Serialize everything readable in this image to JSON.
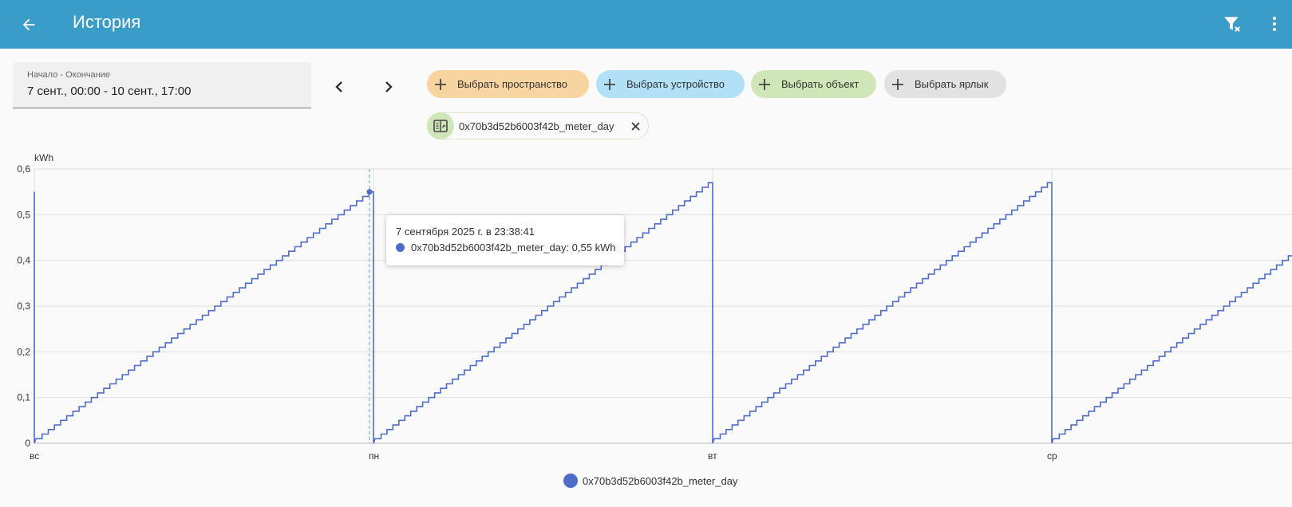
{
  "header": {
    "title": "История",
    "back_icon": "arrow-left-icon",
    "filter_icon": "filter-remove-icon",
    "menu_icon": "dots-vertical-icon",
    "bg_color": "#3a9cc9"
  },
  "date_range": {
    "label": "Начало - Окончание",
    "value": "7 сент., 00:00 - 10 сент., 17:00"
  },
  "nav": {
    "prev_icon": "chevron-left-icon",
    "next_icon": "chevron-right-icon"
  },
  "chips": {
    "area": {
      "label": "Выбрать пространство",
      "color": "#f8d4a1"
    },
    "device": {
      "label": "Выбрать устройство",
      "color": "#b2e0f6"
    },
    "entity": {
      "label": "Выбрать объект",
      "color": "#cfe6b8"
    },
    "label": {
      "label": "Выбрать ярлык",
      "color": "#e2e2e2"
    }
  },
  "selected_entity": {
    "name": "0x70b3d52b6003f42b_meter_day",
    "icon": "meter-icon",
    "close_icon": "close-icon"
  },
  "tooltip": {
    "time": "7 сентября 2025 г. в 23:38:41",
    "value_text": "0x70b3d52b6003f42b_meter_day: 0,55 kWh"
  },
  "legend": {
    "label": "0x70b3d52b6003f42b_meter_day",
    "color": "#4e6cc9"
  },
  "chart_data": {
    "type": "line",
    "step": true,
    "unit_label": "kWh",
    "y_ticks": [
      "0",
      "0,1",
      "0,2",
      "0,3",
      "0,4",
      "0,5",
      "0,6"
    ],
    "ylim": [
      0,
      0.6
    ],
    "x_ticks": [
      "вс",
      "пн",
      "вт",
      "ср"
    ],
    "grid": true,
    "legend_position": "bottom",
    "series": [
      {
        "name": "0x70b3d52b6003f42b_meter_day",
        "color": "#4e6cc9",
        "days": [
          {
            "start_day": 0,
            "end_day": 1,
            "start_value": 0.01,
            "end_value": 0.55
          },
          {
            "start_day": 1,
            "end_day": 2,
            "start_value": 0.01,
            "end_value": 0.57
          },
          {
            "start_day": 2,
            "end_day": 3,
            "start_value": 0.01,
            "end_value": 0.57
          },
          {
            "start_day": 3,
            "end_day": 3.71,
            "start_value": 0.01,
            "end_value": 0.41
          }
        ],
        "initial_value": 0.55
      }
    ],
    "highlight": {
      "day": 1,
      "value": 0.55
    }
  }
}
